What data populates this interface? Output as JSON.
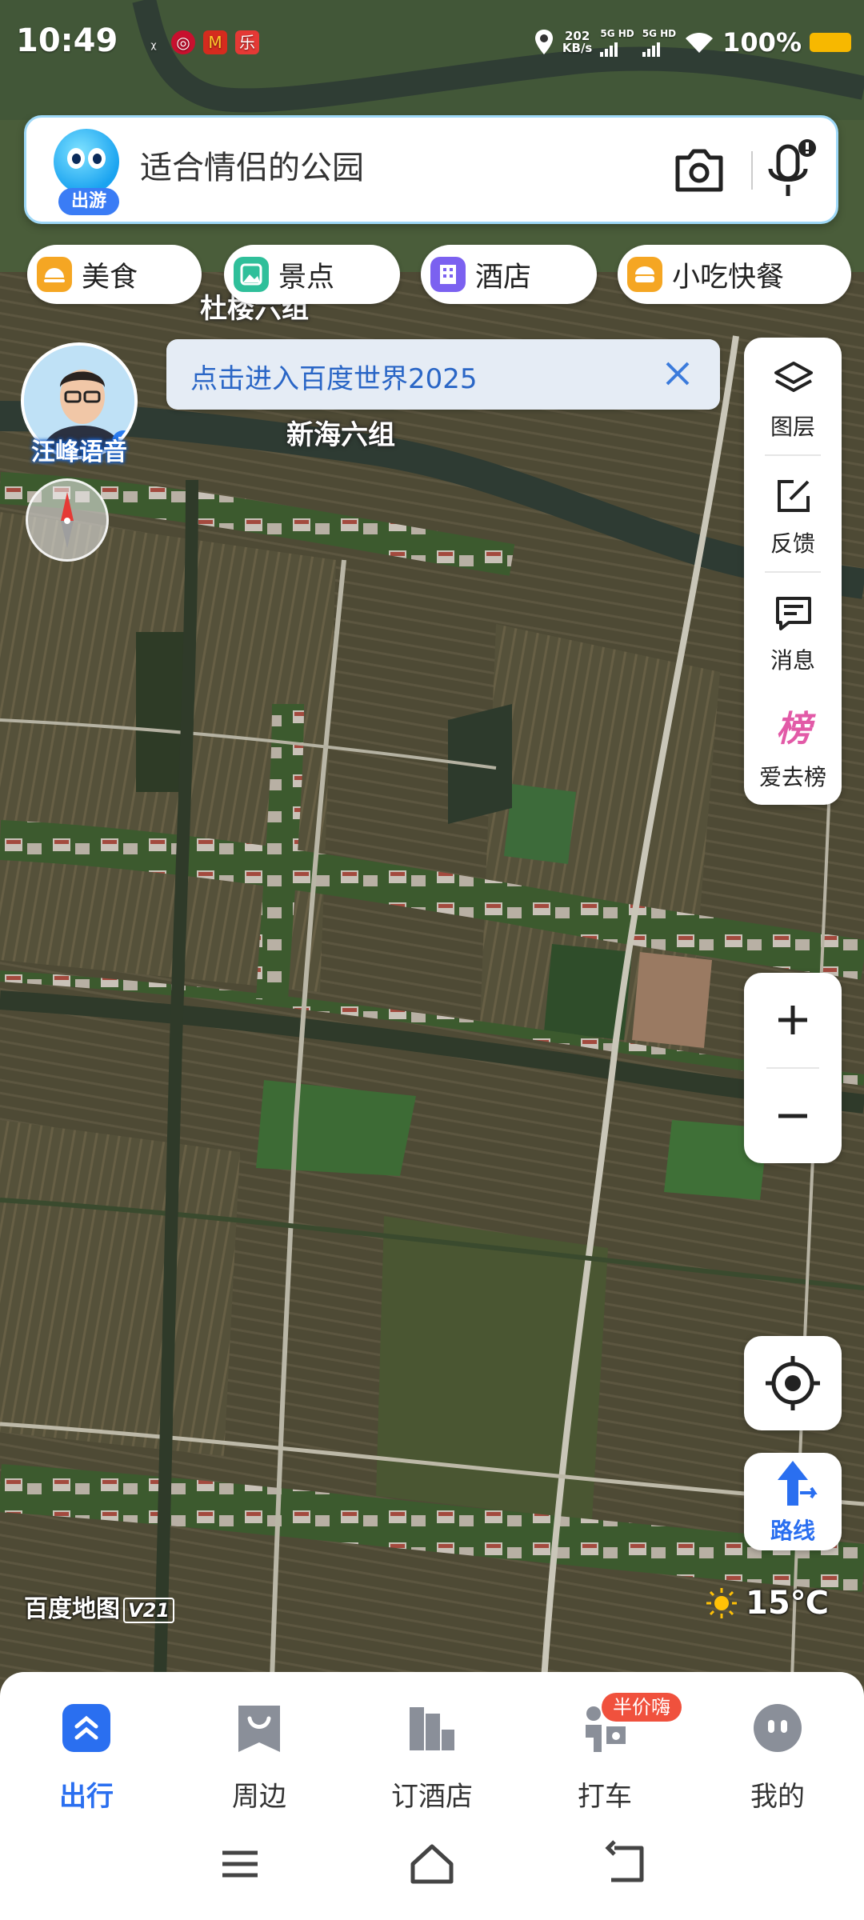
{
  "status_bar": {
    "time": "10:49",
    "net_speed_value": "202",
    "net_speed_unit": "KB/s",
    "signal_1": "5G HD",
    "signal_2": "5G HD",
    "battery": "100%"
  },
  "search": {
    "mascot_tag": "出游",
    "placeholder": "适合情侣的公园",
    "camera_icon": "camera-icon",
    "mic_icon": "microphone-icon"
  },
  "categories": [
    {
      "label": "美食",
      "icon": "food-icon",
      "color": "#f5a623"
    },
    {
      "label": "景点",
      "icon": "scenery-icon",
      "color": "#2fbf9a"
    },
    {
      "label": "酒店",
      "icon": "hotel-icon",
      "color": "#7b61f0"
    },
    {
      "label": "小吃快餐",
      "icon": "snack-icon",
      "color": "#f5a623"
    }
  ],
  "map_labels": {
    "village_1": "杜楼六组",
    "village_2": "新海六组"
  },
  "voice_avatar": {
    "label": "汪峰语音"
  },
  "banner": {
    "text": "点击进入百度世界2025"
  },
  "right_tools": [
    {
      "label": "图层",
      "icon": "layers-icon"
    },
    {
      "label": "反馈",
      "icon": "feedback-icon"
    },
    {
      "label": "消息",
      "icon": "message-icon"
    },
    {
      "label": "爱去榜",
      "icon": "ranking-icon",
      "icon_text": "榜"
    }
  ],
  "map_controls": {
    "zoom_in": "+",
    "zoom_out": "−",
    "route_label": "路线"
  },
  "footer": {
    "logo": "百度地图",
    "version": "V21",
    "temperature": "15℃"
  },
  "bottom_nav": {
    "tabs": [
      {
        "label": "出行",
        "icon": "travel-icon",
        "active": true
      },
      {
        "label": "周边",
        "icon": "nearby-icon",
        "active": false
      },
      {
        "label": "订酒店",
        "icon": "hotel-booking-icon",
        "active": false
      },
      {
        "label": "打车",
        "icon": "taxi-icon",
        "active": false,
        "badge": "半价嗨"
      },
      {
        "label": "我的",
        "icon": "profile-icon",
        "active": false
      }
    ]
  },
  "colors": {
    "accent": "#2a6ff0",
    "badge": "#f0513d",
    "battery": "#f7b800"
  }
}
